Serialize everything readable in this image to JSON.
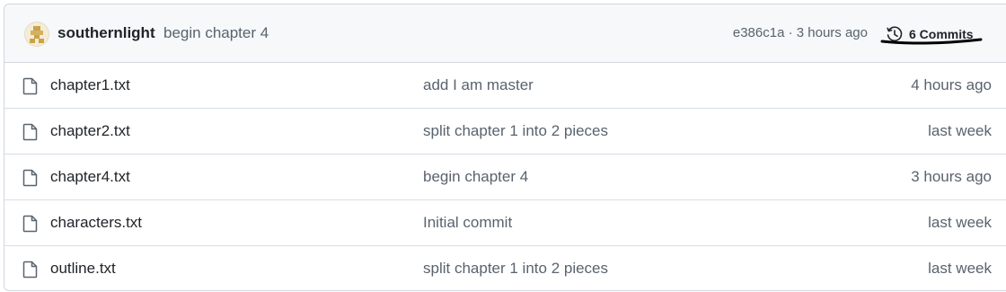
{
  "latest_commit": {
    "author": "southernlight",
    "message": "begin chapter 4",
    "sha": "e386c1a",
    "separator": " · ",
    "time": "3 hours ago",
    "commits_label": "6 Commits"
  },
  "files": [
    {
      "name": "chapter1.txt",
      "message": "add I am master",
      "time": "4 hours ago"
    },
    {
      "name": "chapter2.txt",
      "message": "split chapter 1 into 2 pieces",
      "time": "last week"
    },
    {
      "name": "chapter4.txt",
      "message": "begin chapter 4",
      "time": "3 hours ago"
    },
    {
      "name": "characters.txt",
      "message": "Initial commit",
      "time": "last week"
    },
    {
      "name": "outline.txt",
      "message": "split chapter 1 into 2 pieces",
      "time": "last week"
    }
  ],
  "colors": {
    "header_bg": "#f6f8fa",
    "border": "#d0d7de",
    "text_primary": "#1f2328",
    "text_muted": "#59636e",
    "avatar_gold": "#c9a24a"
  },
  "icons": {
    "history": "history-icon",
    "file": "file-icon",
    "avatar": "avatar"
  }
}
